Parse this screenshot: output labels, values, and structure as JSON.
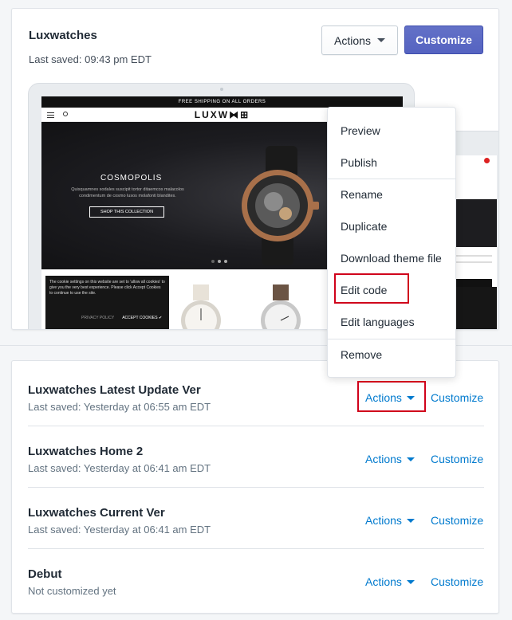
{
  "colors": {
    "accent": "#5c6ac4",
    "link": "#007ace",
    "highlight": "#d0021b"
  },
  "current_theme": {
    "title": "Luxwatches",
    "saved": "Last saved: 09:43 pm EDT",
    "actions_label": "Actions",
    "customize_label": "Customize",
    "preview": {
      "shipping_bar": "FREE SHIPPING ON ALL ORDERS",
      "logo": "LUXW⧓⊞",
      "hero_title": "COSMOPOLIS",
      "hero_copy": "Quisquamnes sodales suscipit tortor ditaemcos malacolos condimentum de cosmo lusos molafonti blandites.",
      "hero_button": "SHOP THIS COLLECTION",
      "cookie_text": "The cookie settings on this website are set to 'allow all cookies' to give you the very best experience. Please click Accept Cookies to continue to use the site.",
      "cookie_policy": "PRIVACY POLICY",
      "cookie_accept": "ACCEPT COOKIES ✔"
    }
  },
  "actions_menu": {
    "items": [
      "Preview",
      "Publish",
      "Rename",
      "Duplicate",
      "Download theme file",
      "Edit code",
      "Edit languages",
      "Remove"
    ]
  },
  "theme_list": [
    {
      "title": "Luxwatches Latest Update Ver",
      "saved": "Last saved: Yesterday at 06:55 am EDT",
      "actions": "Actions",
      "customize": "Customize"
    },
    {
      "title": "Luxwatches Home 2",
      "saved": "Last saved: Yesterday at 06:41 am EDT",
      "actions": "Actions",
      "customize": "Customize"
    },
    {
      "title": "Luxwatches Current Ver",
      "saved": "Last saved: Yesterday at 06:41 am EDT",
      "actions": "Actions",
      "customize": "Customize"
    },
    {
      "title": "Debut",
      "saved": "Not customized yet",
      "actions": "Actions",
      "customize": "Customize"
    }
  ]
}
